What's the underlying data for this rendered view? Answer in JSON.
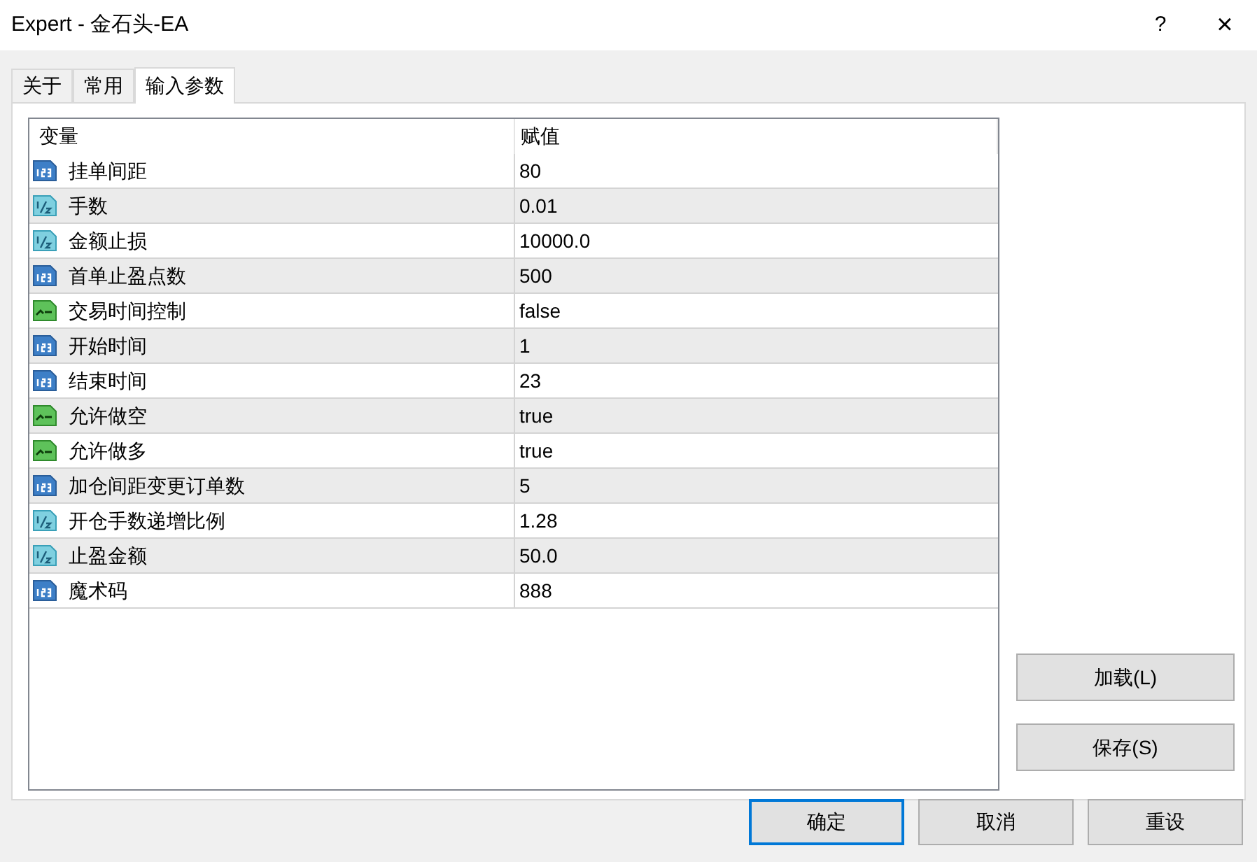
{
  "window": {
    "title": "Expert - 金石头-EA",
    "help": "?",
    "close": "×"
  },
  "tabs": [
    {
      "label": "关于",
      "selected": false
    },
    {
      "label": "常用",
      "selected": false
    },
    {
      "label": "输入参数",
      "selected": true
    }
  ],
  "table": {
    "columns": [
      "变量",
      "赋值"
    ],
    "rows": [
      {
        "kind": "int",
        "name": "挂单间距",
        "value": "80"
      },
      {
        "kind": "double",
        "name": "手数",
        "value": "0.01"
      },
      {
        "kind": "double",
        "name": "金额止损",
        "value": "10000.0"
      },
      {
        "kind": "int",
        "name": "首单止盈点数",
        "value": "500"
      },
      {
        "kind": "bool",
        "name": "交易时间控制",
        "value": "false"
      },
      {
        "kind": "int",
        "name": "开始时间",
        "value": "1"
      },
      {
        "kind": "int",
        "name": "结束时间",
        "value": "23"
      },
      {
        "kind": "bool",
        "name": "允许做空",
        "value": "true"
      },
      {
        "kind": "bool",
        "name": "允许做多",
        "value": "true"
      },
      {
        "kind": "int",
        "name": "加仓间距变更订单数",
        "value": "5"
      },
      {
        "kind": "double",
        "name": "开仓手数递增比例",
        "value": "1.28"
      },
      {
        "kind": "double",
        "name": "止盈金额",
        "value": "50.0"
      },
      {
        "kind": "int",
        "name": "魔术码",
        "value": "888"
      }
    ]
  },
  "side_buttons": [
    "加载(L)",
    "保存(S)"
  ],
  "buttons": [
    {
      "label": "确定",
      "default": true
    },
    {
      "label": "取消",
      "default": false
    },
    {
      "label": "重设",
      "default": false
    }
  ]
}
